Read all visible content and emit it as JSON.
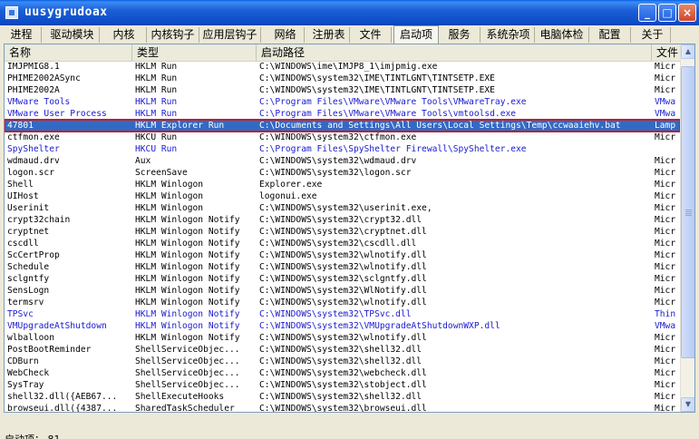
{
  "window": {
    "title": "uusygrudoax",
    "minimize": "_",
    "maximize": "□",
    "close": "×"
  },
  "tabs": [
    {
      "label": "进程"
    },
    {
      "label": "驱动模块"
    },
    {
      "label": "内核"
    },
    {
      "label": "内核钩子"
    },
    {
      "label": "应用层钩子"
    },
    {
      "label": "网络"
    },
    {
      "label": "注册表"
    },
    {
      "label": "文件"
    },
    {
      "label": "启动项",
      "active": true
    },
    {
      "label": "服务"
    },
    {
      "label": "系统杂项"
    },
    {
      "label": "电脑体检"
    },
    {
      "label": "配置"
    },
    {
      "label": "关于"
    }
  ],
  "columns": [
    {
      "label": "名称"
    },
    {
      "label": "类型"
    },
    {
      "label": "启动路径"
    },
    {
      "label": "文件"
    }
  ],
  "rows": [
    {
      "name": "IMJPMIG8.1",
      "type": "HKLM Run",
      "path": "C:\\WINDOWS\\ime\\IMJP8_1\\imjpmig.exe",
      "file": "Micr"
    },
    {
      "name": "PHIME2002ASync",
      "type": "HKLM Run",
      "path": "C:\\WINDOWS\\system32\\IME\\TINTLGNT\\TINTSETP.EXE",
      "file": "Micr"
    },
    {
      "name": "PHIME2002A",
      "type": "HKLM Run",
      "path": "C:\\WINDOWS\\system32\\IME\\TINTLGNT\\TINTSETP.EXE",
      "file": "Micr"
    },
    {
      "name": "VMware Tools",
      "type": "HKLM Run",
      "path": "C:\\Program Files\\VMware\\VMware Tools\\VMwareTray.exe",
      "file": "VMwa",
      "color": "blue"
    },
    {
      "name": "VMware User Process",
      "type": "HKLM Run",
      "path": "C:\\Program Files\\VMware\\VMware Tools\\vmtoolsd.exe",
      "file": "VMwa",
      "color": "blue"
    },
    {
      "name": "47801",
      "type": "HKLM Explorer Run",
      "path": "C:\\Documents and Settings\\All Users\\Local Settings\\Temp\\ccwaaiehv.bat",
      "file": "Lamp",
      "selected": true
    },
    {
      "name": "ctfmon.exe",
      "type": "HKCU Run",
      "path": "C:\\WINDOWS\\system32\\ctfmon.exe",
      "file": "Micr"
    },
    {
      "name": "SpyShelter",
      "type": "HKCU Run",
      "path": "C:\\Program Files\\SpyShelter Firewall\\SpyShelter.exe",
      "file": "",
      "color": "blue"
    },
    {
      "name": "wdmaud.drv",
      "type": "Aux",
      "path": "C:\\WINDOWS\\system32\\wdmaud.drv",
      "file": "Micr"
    },
    {
      "name": "logon.scr",
      "type": "ScreenSave",
      "path": "C:\\WINDOWS\\system32\\logon.scr",
      "file": "Micr"
    },
    {
      "name": "Shell",
      "type": "HKLM Winlogon",
      "path": "Explorer.exe",
      "file": "Micr"
    },
    {
      "name": "UIHost",
      "type": "HKLM Winlogon",
      "path": "logonui.exe",
      "file": "Micr"
    },
    {
      "name": "Userinit",
      "type": "HKLM Winlogon",
      "path": "C:\\WINDOWS\\system32\\userinit.exe,",
      "file": "Micr"
    },
    {
      "name": "crypt32chain",
      "type": "HKLM Winlogon Notify",
      "path": "C:\\WINDOWS\\system32\\crypt32.dll",
      "file": "Micr"
    },
    {
      "name": "cryptnet",
      "type": "HKLM Winlogon Notify",
      "path": "C:\\WINDOWS\\system32\\cryptnet.dll",
      "file": "Micr"
    },
    {
      "name": "cscdll",
      "type": "HKLM Winlogon Notify",
      "path": "C:\\WINDOWS\\system32\\cscdll.dll",
      "file": "Micr"
    },
    {
      "name": "ScCertProp",
      "type": "HKLM Winlogon Notify",
      "path": "C:\\WINDOWS\\system32\\wlnotify.dll",
      "file": "Micr"
    },
    {
      "name": "Schedule",
      "type": "HKLM Winlogon Notify",
      "path": "C:\\WINDOWS\\system32\\wlnotify.dll",
      "file": "Micr"
    },
    {
      "name": "sclgntfy",
      "type": "HKLM Winlogon Notify",
      "path": "C:\\WINDOWS\\system32\\sclgntfy.dll",
      "file": "Micr"
    },
    {
      "name": "SensLogn",
      "type": "HKLM Winlogon Notify",
      "path": "C:\\WINDOWS\\system32\\WlNotify.dll",
      "file": "Micr"
    },
    {
      "name": "termsrv",
      "type": "HKLM Winlogon Notify",
      "path": "C:\\WINDOWS\\system32\\wlnotify.dll",
      "file": "Micr"
    },
    {
      "name": "TPSvc",
      "type": "HKLM Winlogon Notify",
      "path": "C:\\WINDOWS\\system32\\TPSvc.dll",
      "file": "Thin",
      "color": "blue"
    },
    {
      "name": "VMUpgradeAtShutdown",
      "type": "HKLM Winlogon Notify",
      "path": "C:\\WINDOWS\\system32\\VMUpgradeAtShutdownWXP.dll",
      "file": "VMwa",
      "color": "blue"
    },
    {
      "name": "wlballoon",
      "type": "HKLM Winlogon Notify",
      "path": "C:\\WINDOWS\\system32\\wlnotify.dll",
      "file": "Micr"
    },
    {
      "name": "PostBootReminder",
      "type": "ShellServiceObjec...",
      "path": "C:\\WINDOWS\\system32\\shell32.dll",
      "file": "Micr"
    },
    {
      "name": "CDBurn",
      "type": "ShellServiceObjec...",
      "path": "C:\\WINDOWS\\system32\\shell32.dll",
      "file": "Micr"
    },
    {
      "name": "WebCheck",
      "type": "ShellServiceObjec...",
      "path": "C:\\WINDOWS\\system32\\webcheck.dll",
      "file": "Micr"
    },
    {
      "name": "SysTray",
      "type": "ShellServiceObjec...",
      "path": "C:\\WINDOWS\\system32\\stobject.dll",
      "file": "Micr"
    },
    {
      "name": "shell32.dll({AEB67...",
      "type": "ShellExecuteHooks",
      "path": "C:\\WINDOWS\\system32\\shell32.dll",
      "file": "Micr"
    },
    {
      "name": "browseui.dll({4387...",
      "type": "SharedTaskScheduler",
      "path": "C:\\WINDOWS\\system32\\browseui.dll",
      "file": "Micr"
    }
  ],
  "colors": {
    "link_blue": "#1a1ad0",
    "selection": "#316ac5",
    "selection_border": "#c0202a"
  },
  "statusbar": {
    "text": "启动项： 81"
  }
}
